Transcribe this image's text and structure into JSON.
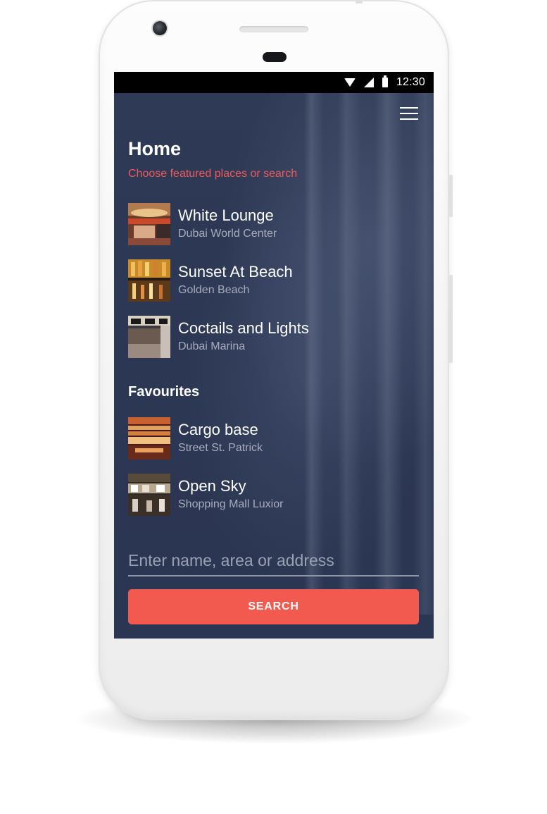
{
  "status_bar": {
    "time": "12:30",
    "icons": [
      "wifi-icon",
      "signal-icon",
      "battery-icon"
    ]
  },
  "header": {
    "menu_icon": "menu-icon",
    "title": "Home",
    "subtitle": "Choose featured places or search"
  },
  "featured": [
    {
      "name": "White Lounge",
      "location": "Dubai World Center"
    },
    {
      "name": "Sunset At Beach",
      "location": "Golden Beach"
    },
    {
      "name": "Coctails and Lights",
      "location": "Dubai Marina"
    }
  ],
  "favourites": {
    "title": "Favourites",
    "items": [
      {
        "name": "Cargo base",
        "location": "Street St. Patrick"
      },
      {
        "name": "Open Sky",
        "location": "Shopping Mall Luxior"
      }
    ]
  },
  "search": {
    "placeholder": "Enter name, area or address",
    "button_label": "SEARCH"
  },
  "colors": {
    "background": "#2c3754",
    "accent": "#f2594f",
    "subtitle": "#f2595a",
    "secondary_text": "#a7adbd"
  }
}
